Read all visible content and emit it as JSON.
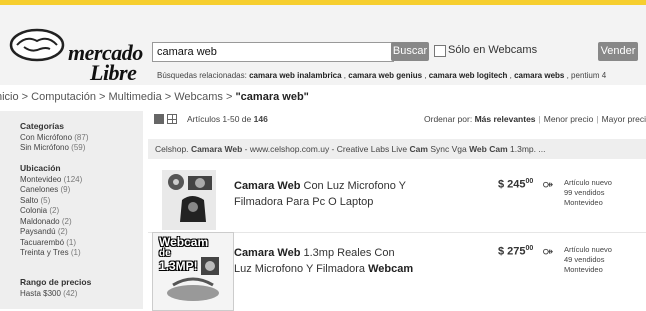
{
  "header": {
    "logo_alt": "Mercado Libre",
    "logo_line1": "mercado",
    "logo_line2": "Libre",
    "search": {
      "value": "camara web",
      "button": "Buscar"
    },
    "filter_checkbox": {
      "label": "Sólo en Webcams",
      "checked": false
    },
    "sell_button": "Vender",
    "related_prefix": "Búsquedas relacionadas:",
    "related": [
      "camara web inalambrica",
      "camara web genius",
      "camara web logitech",
      "camara webs",
      "pentium 4"
    ]
  },
  "breadcrumb": {
    "trail": "nicio > Computación > Multimedia > Webcams > ",
    "current": "\"camara web\""
  },
  "sidebar": {
    "categorias": {
      "title": "Categorías",
      "items": [
        {
          "label": "Con Micrófono",
          "count": "(87)"
        },
        {
          "label": "Sin Micrófono",
          "count": "(59)"
        }
      ]
    },
    "ubicacion": {
      "title": "Ubicación",
      "items": [
        {
          "label": "Montevideo",
          "count": "(124)"
        },
        {
          "label": "Canelones",
          "count": "(9)"
        },
        {
          "label": "Salto",
          "count": "(5)"
        },
        {
          "label": "Colonia",
          "count": "(2)"
        },
        {
          "label": "Maldonado",
          "count": "(2)"
        },
        {
          "label": "Paysandú",
          "count": "(2)"
        },
        {
          "label": "Tacuarembó",
          "count": "(1)"
        },
        {
          "label": "Treinta y Tres",
          "count": "(1)"
        }
      ]
    },
    "precios": {
      "title": "Rango de precios",
      "items": [
        {
          "label": "Hasta $300",
          "count": "(42)"
        }
      ]
    }
  },
  "toolbar": {
    "articles_prefix": "Artículos 1-50 de",
    "articles_total": "146",
    "sort_label": "Ordenar por:",
    "sort_active": "Más relevantes",
    "sort_options": [
      "Menor precio",
      "Mayor precio"
    ]
  },
  "sponsor": {
    "prefix": "Celshop.",
    "bold": "Camara Web",
    "text": " - www.celshop.com.uy - Creative Labs Live ",
    "b2": "Cam",
    "text2": " Sync Vga ",
    "b3": "Web Cam",
    "text3": " 1.3mp. ..."
  },
  "items": [
    {
      "title_bold": "Camara Web",
      "title_rest": " Con Luz Microfono Y Filmadora Para Pc O Laptop",
      "price": "$ 245",
      "cents": "00",
      "condition": "Artículo nuevo",
      "sold": "99 vendidos",
      "location": "Montevideo"
    },
    {
      "title_bold": "Camara Web",
      "title_rest": " 1.3mp Reales Con Luz Microfono Y Filmadora ",
      "title_bold2": "Webcam",
      "price": "$ 275",
      "cents": "00",
      "condition": "Artículo nuevo",
      "sold": "49 vendidos",
      "location": "Montevideo"
    }
  ],
  "badge": {
    "line1": "Webcam",
    "line2": "de",
    "line3": "1.3MP!"
  },
  "colors": {
    "accent": "#f6ce2e",
    "button": "#888888"
  }
}
